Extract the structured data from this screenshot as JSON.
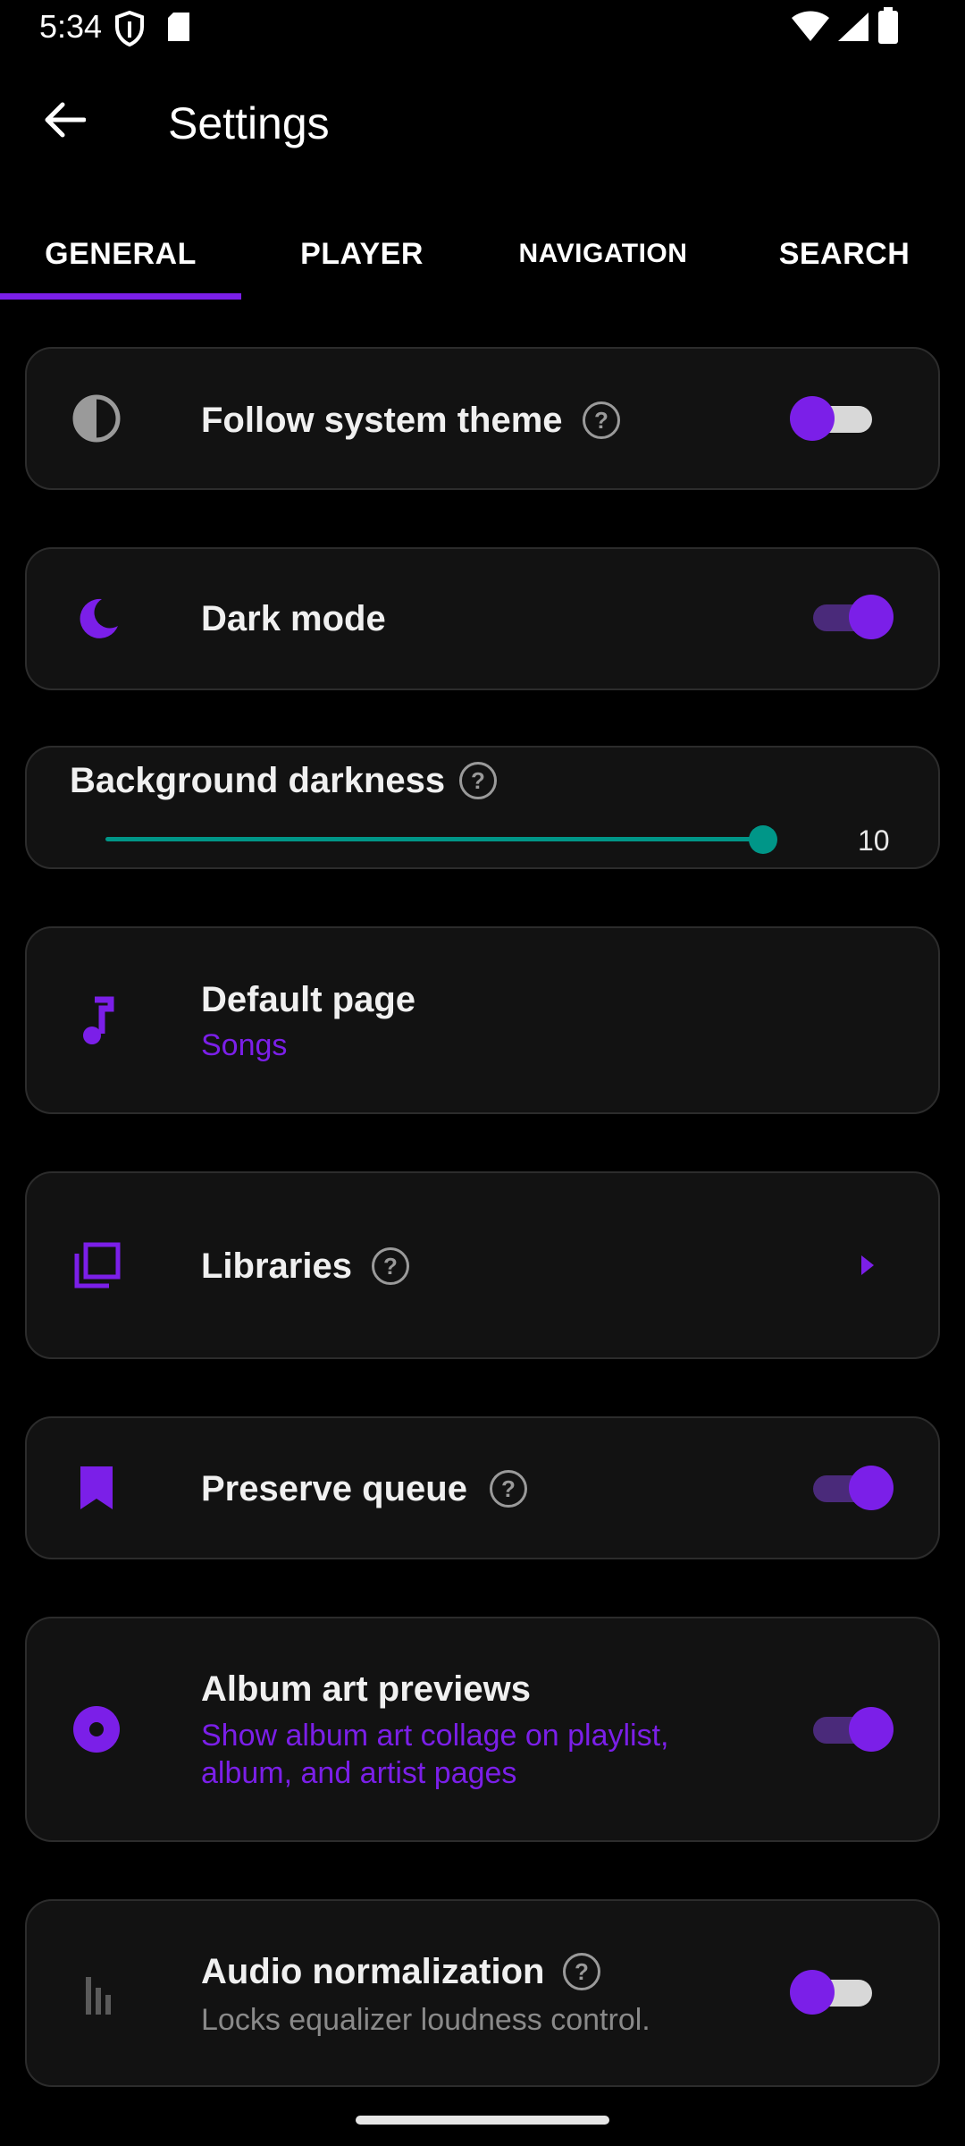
{
  "status_bar": {
    "time": "5:34"
  },
  "app_bar": {
    "title": "Settings"
  },
  "tabs": [
    {
      "label": "GENERAL",
      "selected": true
    },
    {
      "label": "PLAYER"
    },
    {
      "label": "NAVIGATION"
    },
    {
      "label": "SEARCH"
    }
  ],
  "settings": {
    "follow_system_theme": {
      "label": "Follow system theme",
      "enabled": false
    },
    "dark_mode": {
      "label": "Dark mode",
      "enabled": true
    },
    "background_darkness": {
      "label": "Background darkness",
      "value": "10"
    },
    "default_page": {
      "label": "Default page",
      "value": "Songs"
    },
    "libraries": {
      "label": "Libraries"
    },
    "preserve_queue": {
      "label": "Preserve queue",
      "enabled": true
    },
    "album_art_previews": {
      "label": "Album art previews",
      "description": "Show album art collage on playlist, album, and artist pages",
      "enabled": true
    },
    "audio_normalization": {
      "label": "Audio normalization",
      "description": "Locks equalizer loudness control.",
      "enabled": false
    }
  },
  "help_glyph": "?",
  "colors": {
    "accent": "#7b1fe8",
    "slider": "#009688",
    "card_bg": "#121212",
    "background": "#000000"
  }
}
